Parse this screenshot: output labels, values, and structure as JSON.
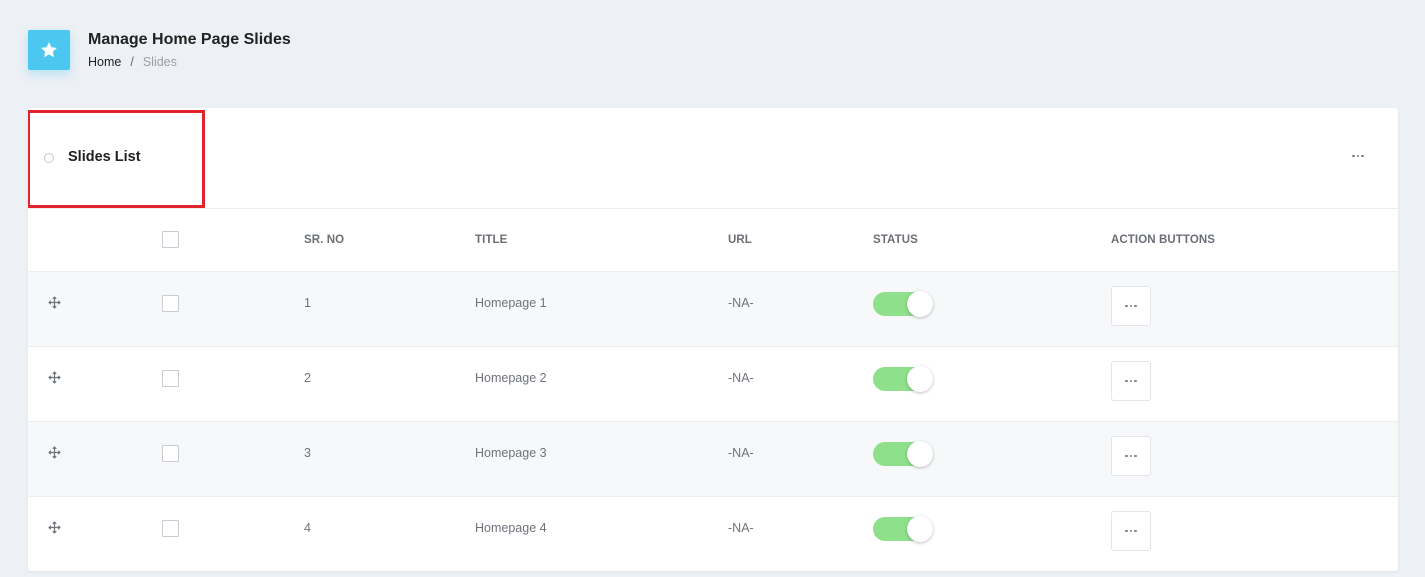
{
  "header": {
    "title": "Manage Home Page Slides",
    "icon": "star-icon",
    "breadcrumb": {
      "home": "Home",
      "separator": "/",
      "current": "Slides"
    }
  },
  "card": {
    "title": "Slides List"
  },
  "table": {
    "columns": {
      "sr_no": "SR. NO",
      "title": "TITLE",
      "url": "URL",
      "status": "STATUS",
      "actions": "ACTION BUTTONS"
    },
    "rows": [
      {
        "sr_no": "1",
        "title": "Homepage 1",
        "url": "-NA-",
        "status": "active"
      },
      {
        "sr_no": "2",
        "title": "Homepage 2",
        "url": "-NA-",
        "status": "active"
      },
      {
        "sr_no": "3",
        "title": "Homepage 3",
        "url": "-NA-",
        "status": "active"
      },
      {
        "sr_no": "4",
        "title": "Homepage 4",
        "url": "-NA-",
        "status": "active"
      }
    ]
  },
  "colors": {
    "accent": "#4cc8f0",
    "toggle_on": "#8ee08b",
    "highlight": "#e3232c",
    "background": "#edf0f5"
  }
}
